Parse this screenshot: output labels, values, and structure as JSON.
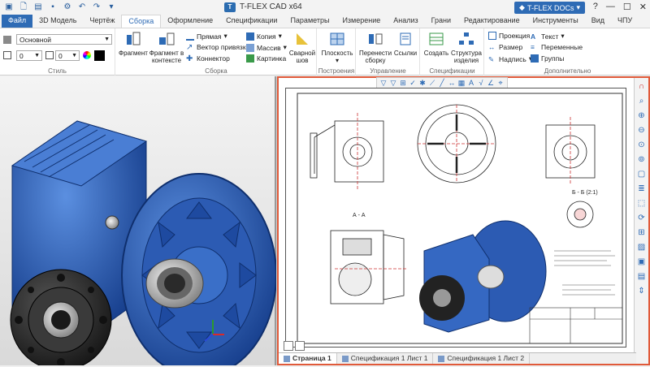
{
  "app_title": "T-FLEX CAD x64",
  "docs_button": "T-FLEX DOCs",
  "menu": [
    "Файл",
    "3D Модель",
    "Чертёж",
    "Сборка",
    "Оформление",
    "Спецификации",
    "Параметры",
    "Измерение",
    "Анализ",
    "Грани",
    "Редактирование",
    "Инструменты",
    "Вид",
    "ЧПУ"
  ],
  "menu_active_index": 3,
  "ribbon": {
    "style": {
      "combo": "Основной",
      "num1": "0",
      "num2": "0",
      "label": "Стиль"
    },
    "assembly": {
      "fragment": "Фрагмент",
      "fragment_ctx": "Фрагмент в контексте",
      "line": "Прямая",
      "bind_vector": "Вектор привязки",
      "connector": "Коннектор",
      "copy": "Копия",
      "array": "Массив",
      "picture": "Картинка",
      "weld": "Сварной шов",
      "label": "Сборка"
    },
    "construct": {
      "plane": "Плоскость",
      "label": "Построения"
    },
    "manage": {
      "move": "Перенести сборку",
      "links": "Ссылки",
      "label": "Управление"
    },
    "spec": {
      "create": "Создать",
      "structure": "Структура изделия",
      "label": "Спецификации"
    },
    "extra": {
      "projection": "Проекция",
      "size": "Размер",
      "inscription": "Надпись",
      "text": "Текст",
      "variables": "Переменные",
      "groups": "Группы",
      "label": "Дополнительно"
    }
  },
  "sheet_tabs": [
    "Страница 1",
    "Спецификация 1 Лист 1",
    "Спецификация 1 Лист 2"
  ],
  "drawing": {
    "section_aa": "А - А",
    "section_bb": "Б - Б (2:1)"
  }
}
